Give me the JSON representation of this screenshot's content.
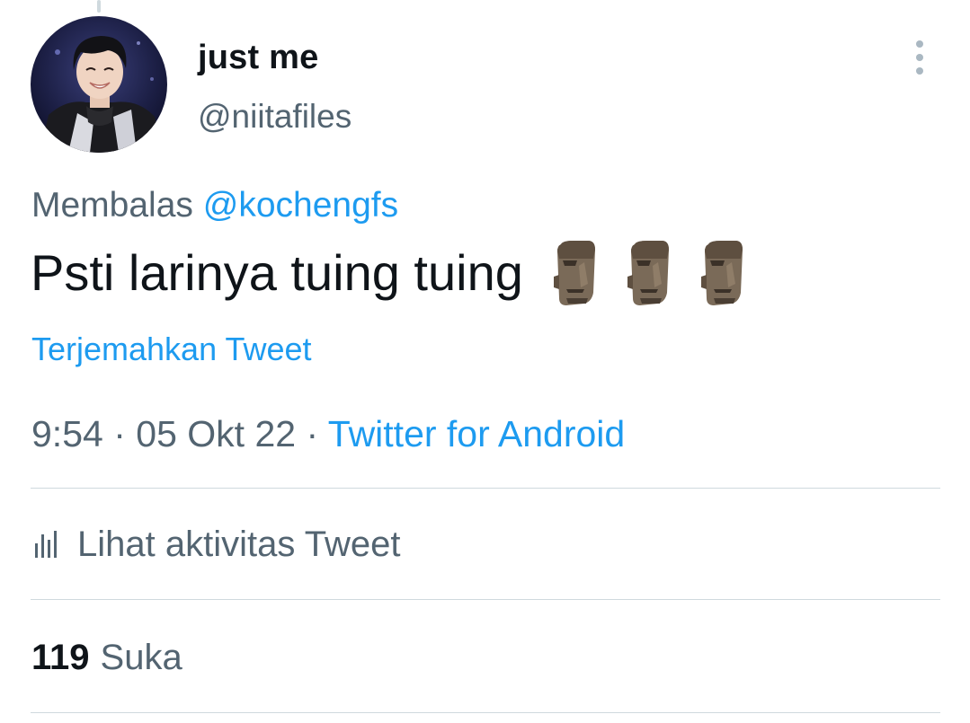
{
  "tweet": {
    "author": {
      "display_name": "just me",
      "handle": "@niitafiles"
    },
    "reply_to": {
      "prefix": "Membalas",
      "mention": "@kochengfs"
    },
    "text": "Psti larinya tuing tuing",
    "emojis": [
      "moai-icon",
      "moai-icon",
      "moai-icon"
    ],
    "translate_label": "Terjemahkan Tweet",
    "time": "9:54",
    "separator": "·",
    "date": "05 Okt 22",
    "source": "Twitter for Android",
    "activity_label": "Lihat aktivitas Tweet",
    "likes_count": "119",
    "likes_label": "Suka"
  },
  "colors": {
    "accent": "#1d9bf0",
    "secondary_text": "#536471",
    "primary_text": "#0f1419",
    "divider": "#cfd9de"
  }
}
